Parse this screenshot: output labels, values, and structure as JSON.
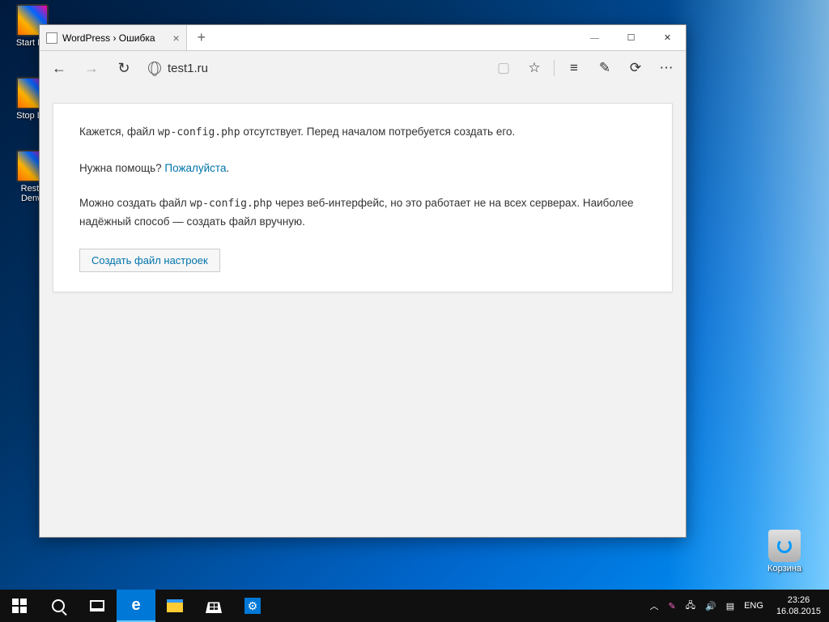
{
  "desktop": {
    "icons": {
      "start_denwer": "Start De",
      "stop_denwer": "Stop De",
      "restart_denwer": "Resta\nDenw",
      "recycle_bin": "Корзина"
    }
  },
  "browser": {
    "tab_title": "WordPress › Ошибка",
    "url": "test1.ru",
    "newtab": "+",
    "close": "×",
    "min": "—",
    "max": "☐",
    "winclose": "✕",
    "back": "←",
    "forward": "→",
    "refresh": "↻",
    "reading": "▢",
    "star": "☆",
    "hub": "≡",
    "note": "✎",
    "share": "⟳",
    "more": "⋯"
  },
  "page": {
    "p1a": "Кажется, файл ",
    "p1code": "wp-config.php",
    "p1b": " отсутствует. Перед началом потребуется создать его.",
    "p2a": "Нужна помощь? ",
    "p2link": "Пожалуйста",
    "p2b": ".",
    "p3a": "Можно создать файл ",
    "p3code": "wp-config.php",
    "p3b": " через веб-интерфейс, но это работает не на всех серверах. Наиболее надёжный способ — создать файл вручную.",
    "button": "Создать файл настроек"
  },
  "taskbar": {
    "lang": "ENG",
    "time": "23:26",
    "date": "16.08.2015",
    "chevron": "︿"
  }
}
